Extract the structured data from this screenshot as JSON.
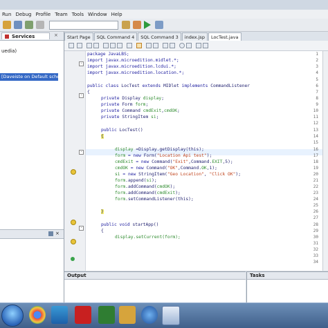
{
  "menu": [
    "Run",
    "Debug",
    "Profile",
    "Team",
    "Tools",
    "Window",
    "Help"
  ],
  "left_panel": {
    "tab_label": "Services",
    "close_glyph": "×",
    "item_partial": "uedia)",
    "selected_item": "[Daveiste on Default schema]",
    "pin_glyph": "×"
  },
  "editor_tabs": [
    "Start Page",
    "SQL Command 4",
    "SQL Command 3",
    "index.jsp",
    "LocTest.java"
  ],
  "active_tab_index": 4,
  "line_numbers": [
    "1",
    "2",
    "3",
    "4",
    "5",
    "6",
    "7",
    "8",
    "9",
    "10",
    "11",
    "12",
    "13",
    "14",
    "15",
    "16",
    "17",
    "18",
    "19",
    "20",
    "21",
    "22",
    "23",
    "24",
    "25",
    "26",
    "27",
    "28",
    "29",
    "30",
    "31",
    "32",
    "33",
    "34"
  ],
  "code": {
    "l1": "package JavaLBS;",
    "l2": "import javax.microedition.midlet.*;",
    "l3": "import javax.microedition.lcdui.*;",
    "l4": "import javax.microedition.location.*;",
    "l6a": "public class ",
    "l6b": "LocTest ",
    "l6c": "extends ",
    "l6d": "MIDlet ",
    "l6e": "implements ",
    "l6f": "CommandListener",
    "l7": "{",
    "l8a": "private ",
    "l8b": "Display ",
    "l8c": "display",
    "l8d": ";",
    "l9a": "private ",
    "l9b": "Form ",
    "l9c": "form",
    "l9d": ";",
    "l10a": "private ",
    "l10b": "Command ",
    "l10c": "cmdExit",
    "l10d": ",",
    "l10e": "cmdOK",
    "l10f": ";",
    "l11a": "private ",
    "l11b": "StringItem ",
    "l11c": "si",
    "l11d": ";",
    "l13a": "public ",
    "l13b": "LocTest()",
    "l14": "{",
    "l16a": "display ",
    "l16b": "=Display.getDisplay(this);",
    "l17a": "form ",
    "l17b": "= new ",
    "l17c": "Form(",
    "l17d": "\"Location Api test\"",
    "l17e": ");",
    "l18a": "cmdExit ",
    "l18b": "= new ",
    "l18c": "Command(",
    "l18d": "\"Exit\"",
    "l18e": ",Command.",
    "l18f": "EXIT",
    "l18g": ",5);",
    "l19a": "cmdOK ",
    "l19b": "= new ",
    "l19c": "Command(",
    "l19d": "\"OK\"",
    "l19e": ",Command.",
    "l19f": "OK",
    "l19g": ",1);",
    "l20a": "si ",
    "l20b": "= new ",
    "l20c": "StringItem(",
    "l20d": "\"Geo Location\"",
    "l20e": ", ",
    "l20f": "\"Click OK\"",
    "l20g": ");",
    "l21a": "form",
    "l21b": ".append(",
    "l21c": "si",
    "l21d": ");",
    "l22a": "form",
    "l22b": ".addCommand(",
    "l22c": "cmdOK",
    "l22d": ");",
    "l23a": "form",
    "l23b": ".addCommand(",
    "l23c": "cmdExit",
    "l23d": ");",
    "l24a": "form",
    "l24b": ".setCommandListener(this);",
    "l26": "}",
    "l28a": "public void ",
    "l28b": "startApp()",
    "l29": "{",
    "l30": "display.setCurrent(form);"
  },
  "bottom": {
    "output_label": "Output",
    "tasks_label": "Tasks"
  },
  "colors": {
    "selection": "#3569c6",
    "keyword": "#2020a0",
    "field": "#2e8b2e",
    "string": "#c0431c",
    "current_line": "#e8f2fe",
    "brace_match": "#f5ef6e"
  }
}
